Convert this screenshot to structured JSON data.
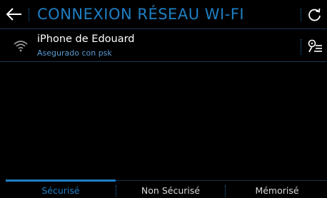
{
  "header": {
    "title": "CONNEXION RÉSEAU WI-FI",
    "back_icon": "arrow-left-icon",
    "refresh_icon": "refresh-icon"
  },
  "networks": [
    {
      "name": "iPhone de Edouard",
      "security": "Asegurado con psk",
      "signal_icon": "wifi-signal-icon",
      "details_icon": "network-details-icon"
    }
  ],
  "tabs": [
    {
      "label": "Sécurisé",
      "active": true
    },
    {
      "label": "Non Sécurisé",
      "active": false
    },
    {
      "label": "Mémorisé",
      "active": false
    }
  ],
  "colors": {
    "accent": "#1e7fc4",
    "background": "#000000",
    "divider": "#1b3550",
    "text": "#ffffff",
    "subtext": "#5a9bd4"
  }
}
